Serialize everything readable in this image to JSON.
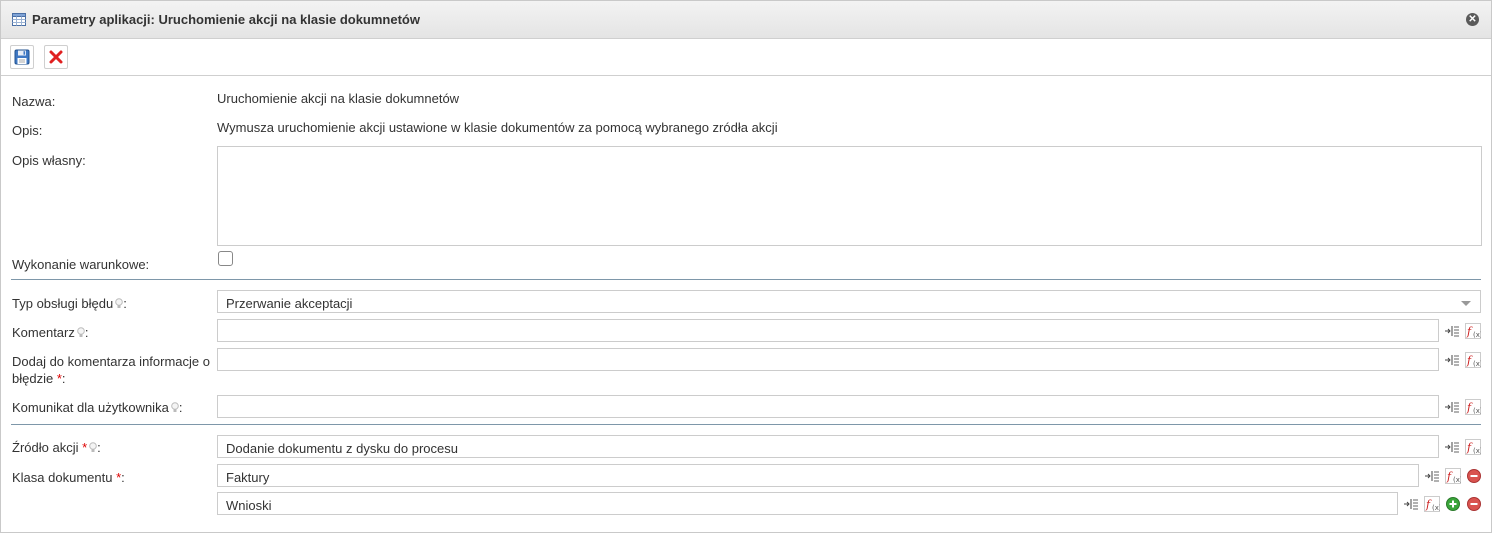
{
  "window": {
    "title": "Parametry aplikacji: Uruchomienie akcji na klasie dokumnetów"
  },
  "form": {
    "name_label": "Nazwa:",
    "name_value": "Uruchomienie akcji na klasie dokumnetów",
    "desc_label": "Opis:",
    "desc_value": "Wymusza uruchomienie akcji ustawione w klasie dokumentów za pomocą wybranego zródła akcji",
    "own_desc_label": "Opis własny:",
    "own_desc_value": "",
    "conditional_label": "Wykonanie warunkowe:",
    "conditional_checked": false,
    "error_type_label": "Typ obsługi błędu",
    "error_type_value": "Przerwanie akceptacji",
    "comment_label": "Komentarz",
    "comment_value": "",
    "add_info_label_line1": "Dodaj do komentarza informacje o",
    "add_info_label_line2": "błędzie",
    "add_info_value": "",
    "user_msg_label": "Komunikat dla użytkownika",
    "user_msg_value": "",
    "source_label": "Źródło akcji",
    "source_value": "Dodanie dokumentu z dysku do procesu",
    "doc_class_label": "Klasa dokumentu",
    "doc_class_values": [
      "Faktury",
      "Wnioski"
    ],
    "colon": ":",
    "required_mark": "*"
  },
  "icons": {
    "title": "table-icon",
    "close": "close-circle-icon",
    "save": "floppy-disk-icon",
    "cancel": "red-x-icon",
    "hint": "lightbulb-icon",
    "insert_var": "insert-variable-icon",
    "function": "function-icon",
    "add": "green-plus-circle-icon",
    "remove": "red-minus-circle-icon"
  },
  "colors": {
    "separator": "#7e97a9",
    "required": "#dd0000",
    "add": "#3aa53a",
    "remove": "#d9534f"
  }
}
